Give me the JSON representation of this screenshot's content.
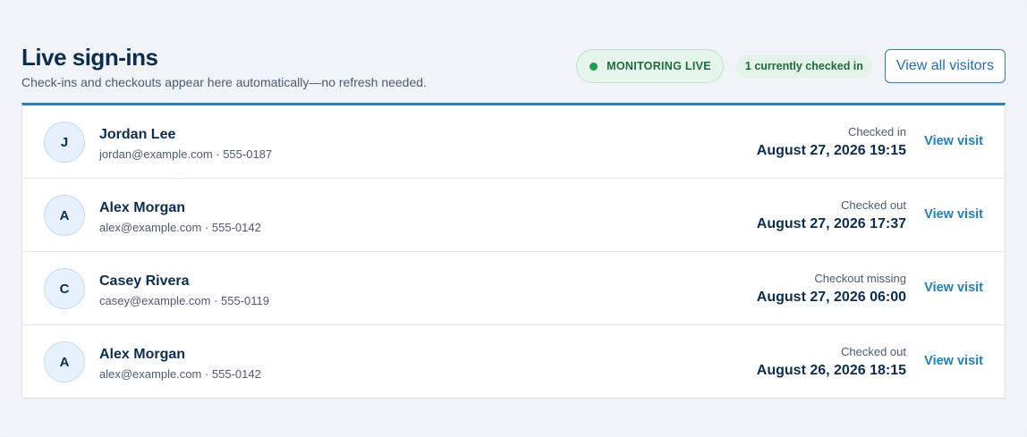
{
  "header": {
    "title": "Live sign-ins",
    "subtitle": "Check-ins and checkouts appear here automatically—no refresh needed.",
    "live_status": "MONITORING LIVE",
    "checked_in_count": "1 currently checked in",
    "view_all_label": "View all visitors"
  },
  "visits": [
    {
      "initial": "J",
      "name": "Jordan Lee",
      "contact": "jordan@example.com · 555-0187",
      "status": "Checked in",
      "time": "August 27, 2026 19:15",
      "action": "View visit"
    },
    {
      "initial": "A",
      "name": "Alex Morgan",
      "contact": "alex@example.com · 555-0142",
      "status": "Checked out",
      "time": "August 27, 2026 17:37",
      "action": "View visit"
    },
    {
      "initial": "C",
      "name": "Casey Rivera",
      "contact": "casey@example.com · 555-0119",
      "status": "Checkout missing",
      "time": "August 27, 2026 06:00",
      "action": "View visit"
    },
    {
      "initial": "A",
      "name": "Alex Morgan",
      "contact": "alex@example.com · 555-0142",
      "status": "Checked out",
      "time": "August 26, 2026 18:15",
      "action": "View visit"
    }
  ],
  "colors": {
    "accent": "#2a7fc4",
    "live_green": "#1f9d55",
    "title_navy": "#0b2d52"
  }
}
